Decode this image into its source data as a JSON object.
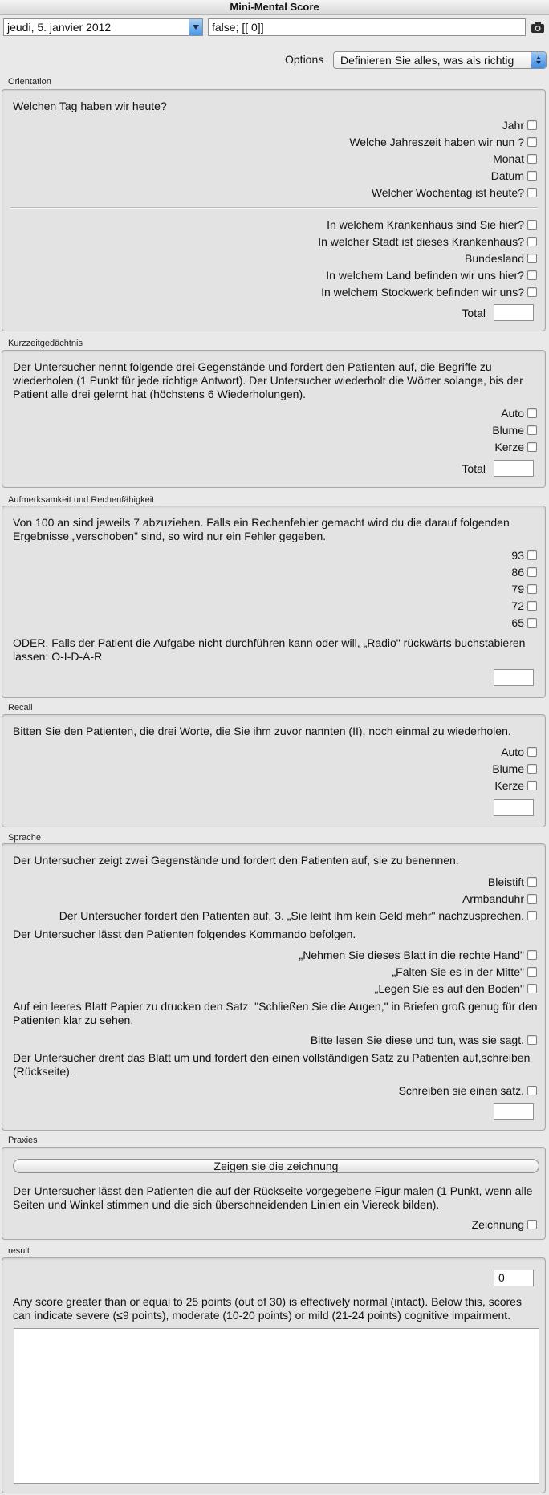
{
  "window": {
    "title": "Mini-Mental Score"
  },
  "toolbar": {
    "date_value": "jeudi, 5. janvier 2012",
    "formula_value": "false; [[ 0]]",
    "camera_icon": "camera-icon"
  },
  "options": {
    "label": "Options",
    "selected": "Definieren Sie alles, was als richtig"
  },
  "orientation": {
    "label": "Orientation",
    "question": "Welchen Tag haben wir heute?",
    "items1": [
      "Jahr",
      "Welche Jahreszeit haben wir nun ?",
      "Monat",
      "Datum",
      "Welcher Wochentag ist heute?"
    ],
    "items2": [
      "In welchem Krankenhaus sind Sie hier?",
      "In welcher Stadt ist dieses Krankenhaus?",
      "Bundesland",
      "In welchem Land befinden wir uns hier?",
      "In welchem Stockwerk befinden wir uns?"
    ],
    "total_label": "Total",
    "total_value": ""
  },
  "kurzzeit": {
    "label": "Kurzzeitgedächtnis",
    "text": "Der Untersucher nennt folgende drei Gegenstände und fordert den Patienten auf, die Begriffe zu wiederholen (1 Punkt für jede richtige Antwort). Der Untersucher wiederholt die Wörter solange, bis der Patient alle drei gelernt hat (höchstens 6 Wiederholungen).",
    "items": [
      "Auto",
      "Blume",
      "Kerze"
    ],
    "total_label": "Total",
    "total_value": ""
  },
  "aufmerksamkeit": {
    "label": "Aufmerksamkeit und Rechenfähigkeit",
    "text": "Von 100 an sind jeweils 7 abzuziehen. Falls ein Rechenfehler gemacht wird du die darauf folgenden Ergebnisse „verschoben\" sind, so wird nur ein Fehler gegeben.",
    "items": [
      "93",
      "86",
      "79",
      "72",
      "65"
    ],
    "alt_text": "ODER. Falls der Patient die Aufgabe nicht durchführen kann oder will, „Radio\" rückwärts buchstabieren lassen: O-I-D-A-R",
    "total_value": ""
  },
  "recall": {
    "label": "Recall",
    "text": "Bitten Sie den Patienten, die drei Worte, die Sie ihm zuvor nannten (II), noch einmal zu wiederholen.",
    "items": [
      "Auto",
      "Blume",
      "Kerze"
    ],
    "total_value": ""
  },
  "sprache": {
    "label": "Sprache",
    "text1": "Der Untersucher zeigt zwei Gegenstände und fordert den Patienten auf, sie zu benennen.",
    "items1": [
      "Bleistift",
      "Armbanduhr",
      "Der Untersucher fordert den Patienten auf, 3. „Sie leiht ihm kein Geld mehr\" nachzusprechen."
    ],
    "text2": "Der Untersucher lässt den Patienten folgendes Kommando befolgen.",
    "items2": [
      "„Nehmen Sie dieses Blatt in die rechte Hand\"",
      "„Falten Sie es in der Mitte\"",
      "„Legen Sie es auf den Boden\""
    ],
    "text3": "Auf ein leeres Blatt Papier zu drucken den Satz: \"Schließen Sie die Augen,\" in Briefen groß genug für den Patienten klar zu sehen.",
    "item3": "Bitte lesen Sie diese und tun, was sie sagt.",
    "text4": "Der Untersucher dreht das Blatt um und fordert den einen vollständigen Satz zu Patienten auf,schreiben (Rückseite).",
    "item4": "Schreiben sie einen satz.",
    "total_value": ""
  },
  "praxies": {
    "label": "Praxies",
    "button_label": "Zeigen sie die zeichnung",
    "text": "Der Untersucher lässt den Patienten die auf der Rückseite vorgegebene Figur malen (1 Punkt, wenn alle Seiten und Winkel stimmen und die sich überschneidenden Linien ein Viereck bilden).",
    "item": "Zeichnung"
  },
  "result": {
    "label": "result",
    "score": "0",
    "text": "Any score greater than or equal to 25 points (out of 30) is effectively normal (intact). Below this, scores can indicate severe (≤9 points), moderate (10-20 points) or mild (21-24 points) cognitive impairment.",
    "notes": ""
  }
}
